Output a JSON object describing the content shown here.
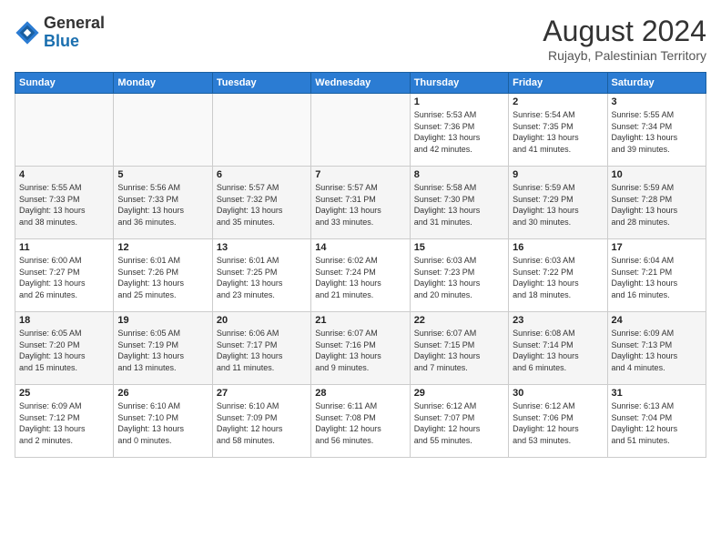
{
  "header": {
    "logo_general": "General",
    "logo_blue": "Blue",
    "month_year": "August 2024",
    "location": "Rujayb, Palestinian Territory"
  },
  "days_of_week": [
    "Sunday",
    "Monday",
    "Tuesday",
    "Wednesday",
    "Thursday",
    "Friday",
    "Saturday"
  ],
  "weeks": [
    {
      "days": [
        {
          "num": "",
          "info": ""
        },
        {
          "num": "",
          "info": ""
        },
        {
          "num": "",
          "info": ""
        },
        {
          "num": "",
          "info": ""
        },
        {
          "num": "1",
          "info": "Sunrise: 5:53 AM\nSunset: 7:36 PM\nDaylight: 13 hours\nand 42 minutes."
        },
        {
          "num": "2",
          "info": "Sunrise: 5:54 AM\nSunset: 7:35 PM\nDaylight: 13 hours\nand 41 minutes."
        },
        {
          "num": "3",
          "info": "Sunrise: 5:55 AM\nSunset: 7:34 PM\nDaylight: 13 hours\nand 39 minutes."
        }
      ]
    },
    {
      "days": [
        {
          "num": "4",
          "info": "Sunrise: 5:55 AM\nSunset: 7:33 PM\nDaylight: 13 hours\nand 38 minutes."
        },
        {
          "num": "5",
          "info": "Sunrise: 5:56 AM\nSunset: 7:33 PM\nDaylight: 13 hours\nand 36 minutes."
        },
        {
          "num": "6",
          "info": "Sunrise: 5:57 AM\nSunset: 7:32 PM\nDaylight: 13 hours\nand 35 minutes."
        },
        {
          "num": "7",
          "info": "Sunrise: 5:57 AM\nSunset: 7:31 PM\nDaylight: 13 hours\nand 33 minutes."
        },
        {
          "num": "8",
          "info": "Sunrise: 5:58 AM\nSunset: 7:30 PM\nDaylight: 13 hours\nand 31 minutes."
        },
        {
          "num": "9",
          "info": "Sunrise: 5:59 AM\nSunset: 7:29 PM\nDaylight: 13 hours\nand 30 minutes."
        },
        {
          "num": "10",
          "info": "Sunrise: 5:59 AM\nSunset: 7:28 PM\nDaylight: 13 hours\nand 28 minutes."
        }
      ]
    },
    {
      "days": [
        {
          "num": "11",
          "info": "Sunrise: 6:00 AM\nSunset: 7:27 PM\nDaylight: 13 hours\nand 26 minutes."
        },
        {
          "num": "12",
          "info": "Sunrise: 6:01 AM\nSunset: 7:26 PM\nDaylight: 13 hours\nand 25 minutes."
        },
        {
          "num": "13",
          "info": "Sunrise: 6:01 AM\nSunset: 7:25 PM\nDaylight: 13 hours\nand 23 minutes."
        },
        {
          "num": "14",
          "info": "Sunrise: 6:02 AM\nSunset: 7:24 PM\nDaylight: 13 hours\nand 21 minutes."
        },
        {
          "num": "15",
          "info": "Sunrise: 6:03 AM\nSunset: 7:23 PM\nDaylight: 13 hours\nand 20 minutes."
        },
        {
          "num": "16",
          "info": "Sunrise: 6:03 AM\nSunset: 7:22 PM\nDaylight: 13 hours\nand 18 minutes."
        },
        {
          "num": "17",
          "info": "Sunrise: 6:04 AM\nSunset: 7:21 PM\nDaylight: 13 hours\nand 16 minutes."
        }
      ]
    },
    {
      "days": [
        {
          "num": "18",
          "info": "Sunrise: 6:05 AM\nSunset: 7:20 PM\nDaylight: 13 hours\nand 15 minutes."
        },
        {
          "num": "19",
          "info": "Sunrise: 6:05 AM\nSunset: 7:19 PM\nDaylight: 13 hours\nand 13 minutes."
        },
        {
          "num": "20",
          "info": "Sunrise: 6:06 AM\nSunset: 7:17 PM\nDaylight: 13 hours\nand 11 minutes."
        },
        {
          "num": "21",
          "info": "Sunrise: 6:07 AM\nSunset: 7:16 PM\nDaylight: 13 hours\nand 9 minutes."
        },
        {
          "num": "22",
          "info": "Sunrise: 6:07 AM\nSunset: 7:15 PM\nDaylight: 13 hours\nand 7 minutes."
        },
        {
          "num": "23",
          "info": "Sunrise: 6:08 AM\nSunset: 7:14 PM\nDaylight: 13 hours\nand 6 minutes."
        },
        {
          "num": "24",
          "info": "Sunrise: 6:09 AM\nSunset: 7:13 PM\nDaylight: 13 hours\nand 4 minutes."
        }
      ]
    },
    {
      "days": [
        {
          "num": "25",
          "info": "Sunrise: 6:09 AM\nSunset: 7:12 PM\nDaylight: 13 hours\nand 2 minutes."
        },
        {
          "num": "26",
          "info": "Sunrise: 6:10 AM\nSunset: 7:10 PM\nDaylight: 13 hours\nand 0 minutes."
        },
        {
          "num": "27",
          "info": "Sunrise: 6:10 AM\nSunset: 7:09 PM\nDaylight: 12 hours\nand 58 minutes."
        },
        {
          "num": "28",
          "info": "Sunrise: 6:11 AM\nSunset: 7:08 PM\nDaylight: 12 hours\nand 56 minutes."
        },
        {
          "num": "29",
          "info": "Sunrise: 6:12 AM\nSunset: 7:07 PM\nDaylight: 12 hours\nand 55 minutes."
        },
        {
          "num": "30",
          "info": "Sunrise: 6:12 AM\nSunset: 7:06 PM\nDaylight: 12 hours\nand 53 minutes."
        },
        {
          "num": "31",
          "info": "Sunrise: 6:13 AM\nSunset: 7:04 PM\nDaylight: 12 hours\nand 51 minutes."
        }
      ]
    }
  ]
}
